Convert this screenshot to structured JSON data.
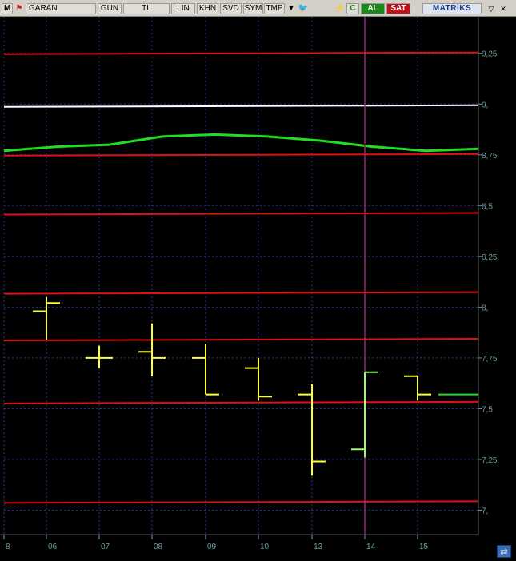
{
  "toolbar": {
    "menu_letter": "M",
    "symbol": "GARAN",
    "period": "GUN",
    "currency": "TL",
    "buttons": [
      "LIN",
      "KHN",
      "SVD",
      "SYM",
      "TMP"
    ],
    "refresh_symbol": "C",
    "buy_label": "AL",
    "sell_label": "SAT",
    "brand": "MATRiKS"
  },
  "chart_data": {
    "type": "line",
    "ylim": [
      6.88,
      9.43
    ],
    "y_ticks": [
      "9,25",
      "9,",
      "8,75",
      "8,5",
      "8,25",
      "8,",
      "7,75",
      "7,5",
      "7,25",
      "7,"
    ],
    "y_tick_values": [
      9.25,
      9.0,
      8.75,
      8.5,
      8.25,
      8.0,
      7.75,
      7.5,
      7.25,
      7.0
    ],
    "x_ticks": [
      "8",
      "06",
      "07",
      "08",
      "09",
      "10",
      "13",
      "14",
      "15"
    ],
    "horizontal_levels": [
      {
        "color": "#e01010",
        "value": 9.25
      },
      {
        "color": "#ffffff",
        "value": 8.99
      },
      {
        "color": "#e01010",
        "value": 8.75
      },
      {
        "color": "#e01010",
        "value": 8.46
      },
      {
        "color": "#e01010",
        "value": 8.07
      },
      {
        "color": "#e01010",
        "value": 7.84
      },
      {
        "color": "#e01010",
        "value": 7.53
      },
      {
        "color": "#e01010",
        "value": 7.04
      }
    ],
    "moving_average": {
      "color": "#22dd22",
      "values": [
        8.77,
        8.79,
        8.8,
        8.84,
        8.85,
        8.84,
        8.82,
        8.79,
        8.77,
        8.78
      ]
    },
    "bars": [
      {
        "date": "06",
        "open": 7.98,
        "high": 8.05,
        "low": 7.84,
        "close": 8.02,
        "color": "#ffff33"
      },
      {
        "date": "07",
        "open": 7.75,
        "high": 7.81,
        "low": 7.7,
        "close": 7.75,
        "color": "#ffff33"
      },
      {
        "date": "08",
        "open": 7.78,
        "high": 7.92,
        "low": 7.66,
        "close": 7.75,
        "color": "#ffff33"
      },
      {
        "date": "09",
        "open": 7.75,
        "high": 7.82,
        "low": 7.57,
        "close": 7.57,
        "color": "#ffff33"
      },
      {
        "date": "10",
        "open": 7.7,
        "high": 7.75,
        "low": 7.54,
        "close": 7.56,
        "color": "#ffff33"
      },
      {
        "date": "13",
        "open": 7.57,
        "high": 7.62,
        "low": 7.17,
        "close": 7.24,
        "color": "#ffff33"
      },
      {
        "date": "14",
        "open": 7.3,
        "high": 7.68,
        "low": 7.26,
        "close": 7.68,
        "color": "#99ff66"
      },
      {
        "date": "15",
        "open": 7.66,
        "high": 7.66,
        "low": 7.54,
        "close": 7.57,
        "color": "#ffff33"
      }
    ],
    "last_price": 7.57,
    "crosshair_date": "14"
  }
}
